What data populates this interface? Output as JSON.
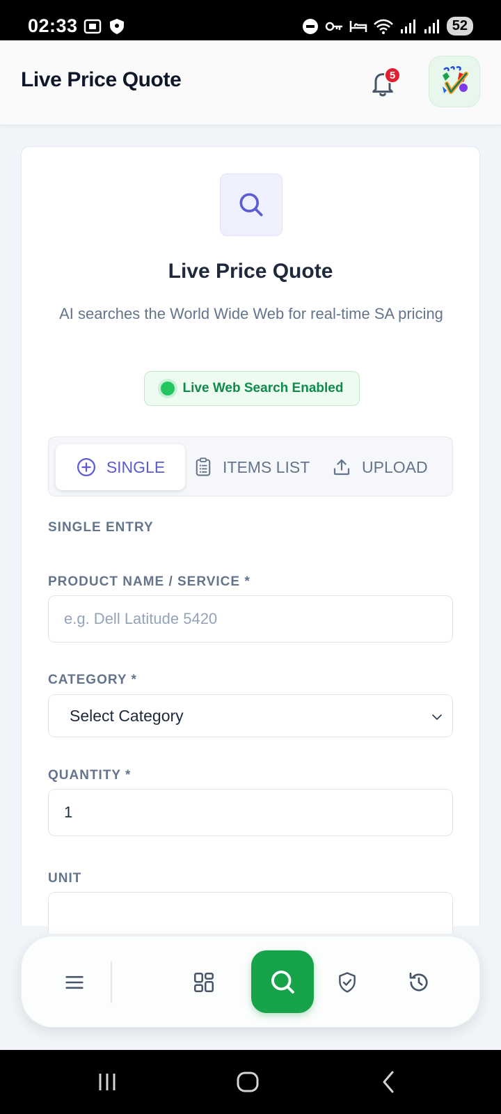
{
  "status_bar": {
    "time": "02:33",
    "battery": "52"
  },
  "header": {
    "title": "Live Price Quote",
    "notification_count": "5"
  },
  "card": {
    "title": "Live Price Quote",
    "subtitle": "AI searches the World Wide Web for real-time SA pricing",
    "live_badge": "Live Web Search Enabled"
  },
  "tabs": [
    {
      "label": "SINGLE",
      "icon": "plus-circle-icon",
      "active": true
    },
    {
      "label": "ITEMS LIST",
      "icon": "clipboard-list-icon",
      "active": false
    },
    {
      "label": "UPLOAD",
      "icon": "upload-icon",
      "active": false
    }
  ],
  "form": {
    "section_title": "SINGLE ENTRY",
    "product_label": "PRODUCT NAME / SERVICE *",
    "product_placeholder": "e.g. Dell Latitude 5420",
    "product_value": "",
    "category_label": "CATEGORY *",
    "category_value": "Select Category",
    "quantity_label": "QUANTITY *",
    "quantity_value": "1",
    "unit_label": "UNIT"
  },
  "bottom_nav": [
    {
      "name": "menu",
      "icon": "menu-icon"
    },
    {
      "name": "dashboard",
      "icon": "grid-icon"
    },
    {
      "name": "search",
      "icon": "search-icon",
      "active": true
    },
    {
      "name": "compliance",
      "icon": "shield-check-icon"
    },
    {
      "name": "history",
      "icon": "history-icon"
    }
  ],
  "colors": {
    "accent": "#5b5bd6",
    "primary_green": "#16a34a",
    "live_green": "#22c55e",
    "badge_red": "#e11d2e"
  }
}
